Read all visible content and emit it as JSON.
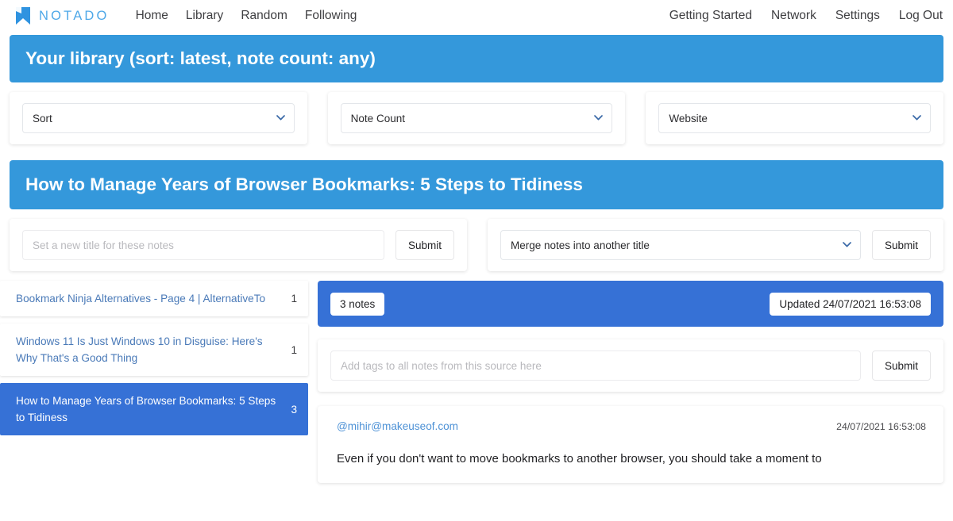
{
  "navbar": {
    "brand": {
      "name": "NOTADO",
      "icon": "bookmark-logo-icon",
      "color": "#4ea8e8"
    },
    "left_links": [
      {
        "label": "Home"
      },
      {
        "label": "Library"
      },
      {
        "label": "Random"
      },
      {
        "label": "Following"
      }
    ],
    "right_links": [
      {
        "label": "Getting Started"
      },
      {
        "label": "Network"
      },
      {
        "label": "Settings"
      },
      {
        "label": "Log Out"
      }
    ]
  },
  "library_banner": {
    "title": "Your library (sort: latest, note count: any)",
    "color": "#3498db"
  },
  "filters": [
    {
      "name": "sort",
      "value": "Sort",
      "icon": "chevron-down-icon"
    },
    {
      "name": "note-count",
      "value": "Note Count",
      "icon": "chevron-down-icon"
    },
    {
      "name": "website",
      "value": "Website",
      "icon": "chevron-down-icon"
    }
  ],
  "title_banner": {
    "title": "How to Manage Years of Browser Bookmarks: 5 Steps to Tidiness",
    "color": "#3498db"
  },
  "actions": {
    "rename": {
      "placeholder": "Set a new title for these notes",
      "value": "",
      "submit_label": "Submit"
    },
    "merge": {
      "value": "Merge notes into another title",
      "icon": "chevron-down-icon",
      "submit_label": "Submit"
    }
  },
  "sources": [
    {
      "title": "Bookmark Ninja Alternatives - Page 4 | AlternativeTo",
      "count": "1",
      "active": false
    },
    {
      "title": "Windows 11 Is Just Windows 10 in Disguise: Here's Why That's a Good Thing",
      "count": "1",
      "active": false
    },
    {
      "title": "How to Manage Years of Browser Bookmarks: 5 Steps to Tidiness",
      "count": "3",
      "active": true
    }
  ],
  "notes_header": {
    "note_count_label": "3 notes",
    "updated_label": "Updated 24/07/2021 16:53:08",
    "color": "#3671d6"
  },
  "tags": {
    "placeholder": "Add tags to all notes from this source here",
    "value": "",
    "submit_label": "Submit"
  },
  "note": {
    "author": "@mihir@makeuseof.com",
    "date": "24/07/2021 16:53:08",
    "body": "Even if you don't want to move bookmarks to another browser, you should take a moment to"
  }
}
